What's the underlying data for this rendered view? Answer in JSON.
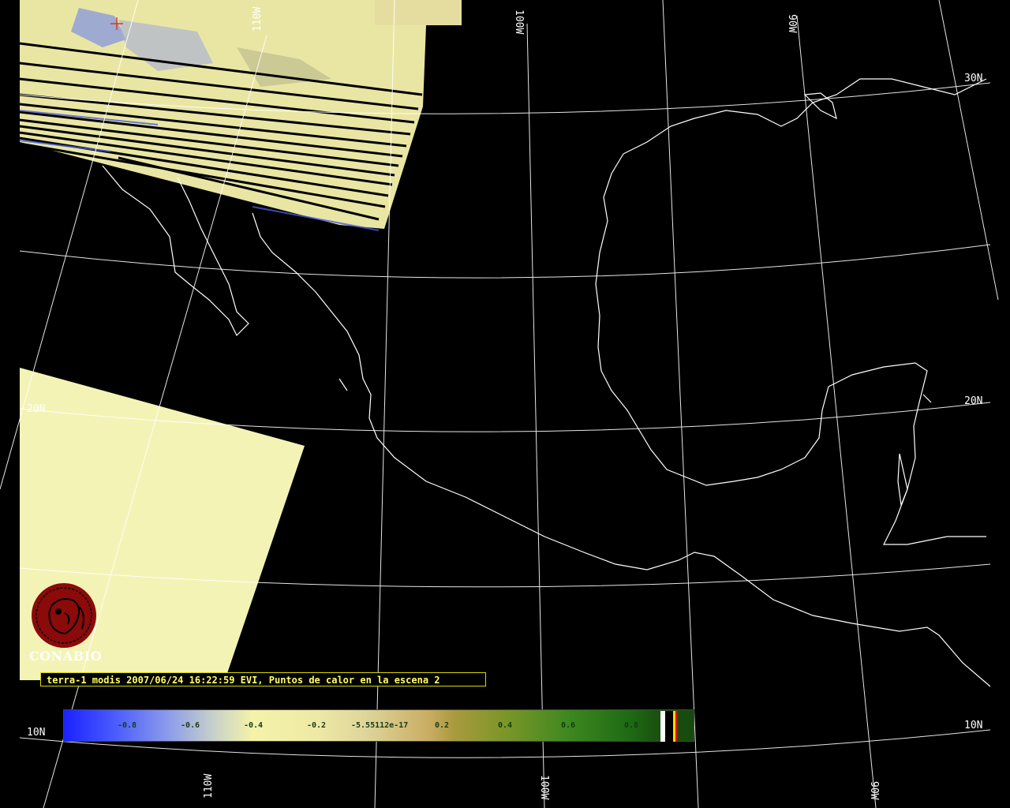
{
  "caption": "terra-1 modis 2007/06/24 16:22:59 EVI, Puntos de calor en la escena 2",
  "logo": {
    "text": "CONABIO",
    "color": "#8b0a0a"
  },
  "grid_labels": {
    "lon_110w_top": "110W",
    "lon_100w_top": "100W",
    "lon_90w_top": "90W",
    "lon_110w_bottom": "110W",
    "lon_100w_bottom": "100W",
    "lon_90w_bottom": "90W",
    "lat_30n": "30N",
    "lat_20n_left": "20N",
    "lat_20n_right": "20N",
    "lat_10n_left": "10N",
    "lat_10n_right": "10N"
  },
  "colorbar": {
    "ticks": [
      "-0.8",
      "-0.6",
      "-0.4",
      "-0.2",
      "-5.55112e-17",
      "0.2",
      "0.4",
      "0.6",
      "0.8"
    ],
    "special_colors": [
      "#ffffff",
      "#000000",
      "#ffd700",
      "#e00000"
    ]
  },
  "colors": {
    "background": "#000000",
    "grid": "#ffffff",
    "coastline": "#ffffff",
    "swath_pale": "#f3f3b6",
    "caption_text": "#ffff66"
  }
}
